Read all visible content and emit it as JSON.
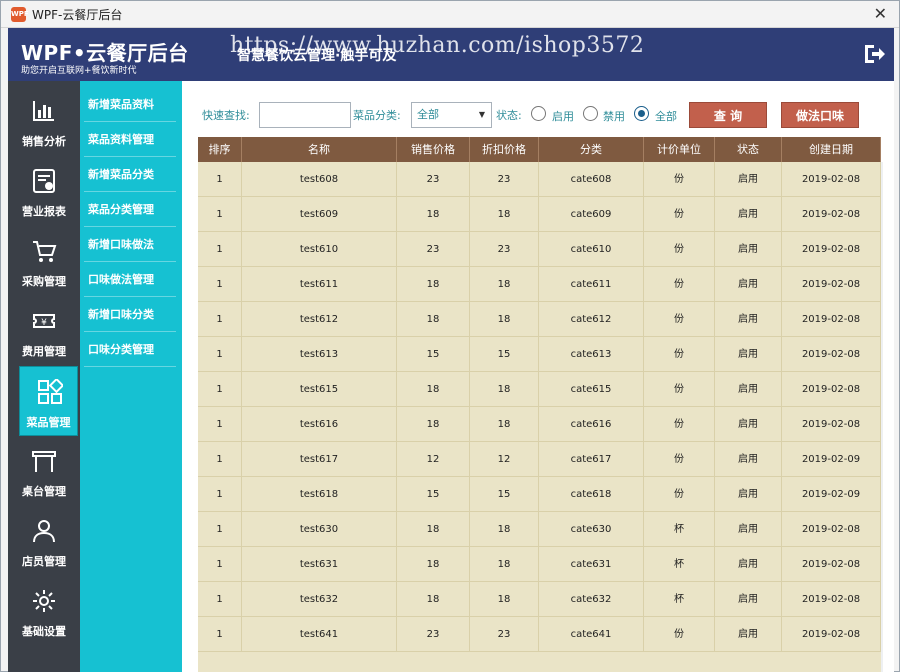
{
  "window": {
    "title": "WPF-云餐厅后台",
    "close_glyph": "✕"
  },
  "header": {
    "brand": "WPF•云餐厅后台",
    "brand_sub": "助您开启互联网+餐饮新时代",
    "slogan": "智慧餐饮云管理·触手可及",
    "watermark": "https://www.huzhan.com/ishop3572",
    "exit_icon": "exit-icon",
    "bg_color": "#2f3e77"
  },
  "nav": [
    {
      "label": "销售分析",
      "icon": "bar-chart-icon"
    },
    {
      "label": "营业报表",
      "icon": "report-icon"
    },
    {
      "label": "采购管理",
      "icon": "cart-icon"
    },
    {
      "label": "费用管理",
      "icon": "ticket-icon"
    },
    {
      "label": "菜品管理",
      "icon": "grid-icon",
      "active": true
    },
    {
      "label": "桌台管理",
      "icon": "table-icon"
    },
    {
      "label": "店员管理",
      "icon": "user-icon"
    },
    {
      "label": "基础设置",
      "icon": "gear-icon"
    }
  ],
  "submenu": [
    "新增菜品资料",
    "菜品资料管理",
    "新增菜品分类",
    "菜品分类管理",
    "新增口味做法",
    "口味做法管理",
    "新增口味分类",
    "口味分类管理"
  ],
  "filter": {
    "quick_search_label": "快速查找:",
    "quick_search_value": "",
    "category_label": "菜品分类:",
    "category_value": "全部",
    "status_label": "状态:",
    "radio_enabled": "启用",
    "radio_disabled": "禁用",
    "radio_all": "全部",
    "radio_selected": "全部",
    "query_button": "查 询",
    "taste_button": "做法口味"
  },
  "table": {
    "columns": [
      "排序",
      "名称",
      "销售价格",
      "折扣价格",
      "分类",
      "计价单位",
      "状态",
      "创建日期"
    ],
    "rows": [
      [
        "1",
        "test608",
        "23",
        "23",
        "cate608",
        "份",
        "启用",
        "2019-02-08"
      ],
      [
        "1",
        "test609",
        "18",
        "18",
        "cate609",
        "份",
        "启用",
        "2019-02-08"
      ],
      [
        "1",
        "test610",
        "23",
        "23",
        "cate610",
        "份",
        "启用",
        "2019-02-08"
      ],
      [
        "1",
        "test611",
        "18",
        "18",
        "cate611",
        "份",
        "启用",
        "2019-02-08"
      ],
      [
        "1",
        "test612",
        "18",
        "18",
        "cate612",
        "份",
        "启用",
        "2019-02-08"
      ],
      [
        "1",
        "test613",
        "15",
        "15",
        "cate613",
        "份",
        "启用",
        "2019-02-08"
      ],
      [
        "1",
        "test615",
        "18",
        "18",
        "cate615",
        "份",
        "启用",
        "2019-02-08"
      ],
      [
        "1",
        "test616",
        "18",
        "18",
        "cate616",
        "份",
        "启用",
        "2019-02-08"
      ],
      [
        "1",
        "test617",
        "12",
        "12",
        "cate617",
        "份",
        "启用",
        "2019-02-09"
      ],
      [
        "1",
        "test618",
        "15",
        "15",
        "cate618",
        "份",
        "启用",
        "2019-02-09"
      ],
      [
        "1",
        "test630",
        "18",
        "18",
        "cate630",
        "杯",
        "启用",
        "2019-02-08"
      ],
      [
        "1",
        "test631",
        "18",
        "18",
        "cate631",
        "杯",
        "启用",
        "2019-02-08"
      ],
      [
        "1",
        "test632",
        "18",
        "18",
        "cate632",
        "杯",
        "启用",
        "2019-02-08"
      ],
      [
        "1",
        "test641",
        "23",
        "23",
        "cate641",
        "份",
        "启用",
        "2019-02-08"
      ]
    ],
    "header_color": "#7f5a40",
    "row_color": "#eae4c7"
  },
  "colors": {
    "accent": "#16c1d2",
    "button": "#c2604c",
    "nav_bg": "#3a3f47"
  }
}
